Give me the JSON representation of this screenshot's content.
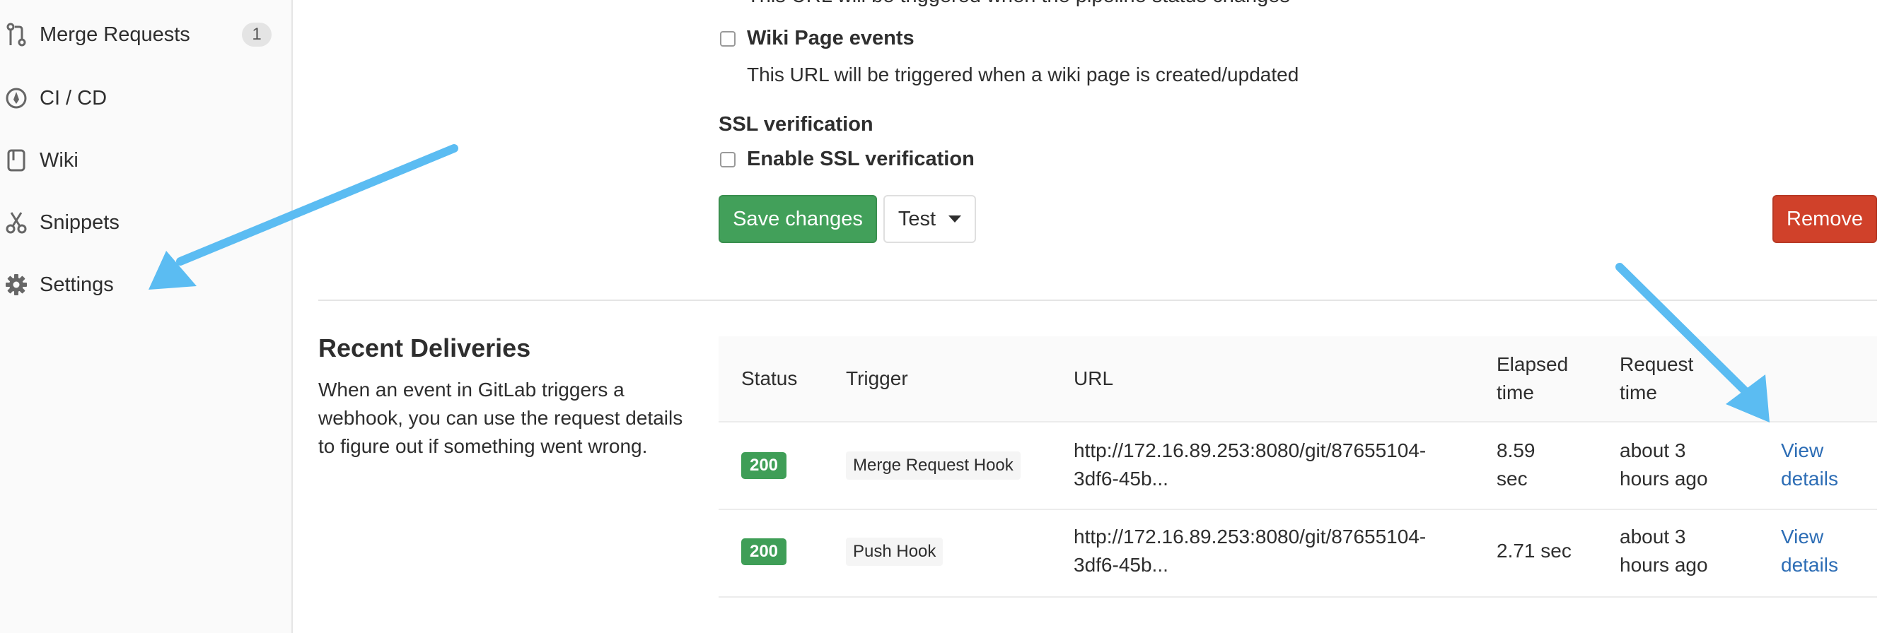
{
  "sidebar": {
    "items": [
      {
        "label": "Merge Requests",
        "count": "1",
        "icon": "merge-request-icon"
      },
      {
        "label": "CI / CD",
        "icon": "rocket-icon"
      },
      {
        "label": "Wiki",
        "icon": "book-icon"
      },
      {
        "label": "Snippets",
        "icon": "scissors-icon"
      },
      {
        "label": "Settings",
        "icon": "gear-icon"
      }
    ]
  },
  "form": {
    "pipeline_help": "This URL will be triggered when the pipeline status changes",
    "wiki_label": "Wiki Page events",
    "wiki_help": "This URL will be triggered when a wiki page is created/updated",
    "ssl_section": "SSL verification",
    "ssl_label": "Enable SSL verification",
    "save_label": "Save changes",
    "test_label": "Test",
    "remove_label": "Remove"
  },
  "recent": {
    "title": "Recent Deliveries",
    "description": "When an event in GitLab triggers a webhook, you can use the request details to figure out if something went wrong.",
    "columns": {
      "status": "Status",
      "trigger": "Trigger",
      "url": "URL",
      "elapsed_1": "Elapsed",
      "elapsed_2": "time",
      "request_1": "Request",
      "request_2": "time"
    },
    "rows": [
      {
        "status": "200",
        "trigger": "Merge Request Hook",
        "url_1": "http://172.16.89.253:8080/git/87655104-",
        "url_2": "3df6-45b...",
        "elapsed_1": "8.59",
        "elapsed_2": "sec",
        "request_1": "about 3",
        "request_2": "hours ago",
        "link_1": "View",
        "link_2": "details"
      },
      {
        "status": "200",
        "trigger": "Push Hook",
        "url_1": "http://172.16.89.253:8080/git/87655104-",
        "url_2": "3df6-45b...",
        "elapsed_1": "2.71 sec",
        "elapsed_2": "",
        "request_1": "about 3",
        "request_2": "hours ago",
        "link_1": "View",
        "link_2": "details"
      }
    ]
  },
  "colors": {
    "save": "#42a05a",
    "remove": "#d0412a",
    "status": "#3f9e57",
    "link": "#2d6db5",
    "annotation": "#5bbcf2"
  }
}
